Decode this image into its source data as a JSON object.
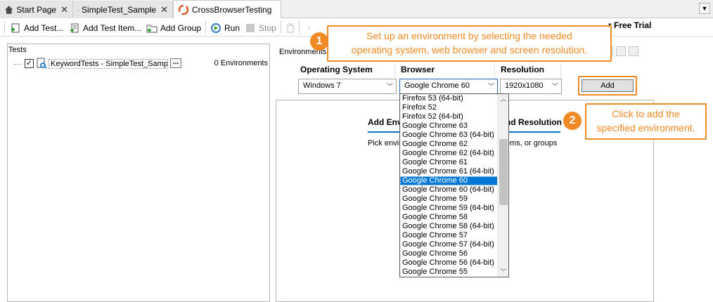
{
  "tabs": [
    {
      "label": "Start Page",
      "icon": "home-icon"
    },
    {
      "label": "SimpleTest_Sample",
      "icon": "project-icon"
    },
    {
      "label": "CrossBrowserTesting",
      "icon": "crossbrowser-icon",
      "active": true
    }
  ],
  "toolbar": {
    "add_test": "Add Test...",
    "add_test_item": "Add Test Item...",
    "add_group": "Add Group",
    "run": "Run",
    "stop": "Stop",
    "free_trial": "r Free Trial"
  },
  "left_pane": {
    "header": "Tests",
    "row": {
      "checked": true,
      "label": "KeywordTests - SimpleTest_Sample",
      "ellipsis": "...",
      "env_count": "0 Environments"
    }
  },
  "right_pane": {
    "environments_label": "Environments",
    "headers": {
      "os": "Operating System",
      "browser": "Browser",
      "resolution": "Resolution"
    },
    "os_value": "Windows 7",
    "browser_value": "Google Chrome 60",
    "resolution_value": "1920x1080",
    "add_button": "Add",
    "add_env_title_a": "Add Env",
    "add_env_title_b": "nd Resolution",
    "pick_hint_a": "Pick envir",
    "pick_hint_b": "ems, or groups"
  },
  "browser_options": [
    "Firefox 53 (64-bit)",
    "Firefox 52",
    "Firefox 52 (64-bit)",
    "Google Chrome 63",
    "Google Chrome 63 (64-bit)",
    "Google Chrome 62",
    "Google Chrome 62 (64-bit)",
    "Google Chrome 61",
    "Google Chrome 61 (64-bit)",
    "Google Chrome 60",
    "Google Chrome 60 (64-bit)",
    "Google Chrome 59",
    "Google Chrome 59 (64-bit)",
    "Google Chrome 58",
    "Google Chrome 58 (64-bit)",
    "Google Chrome 57",
    "Google Chrome 57 (64-bit)",
    "Google Chrome 56",
    "Google Chrome 56 (64-bit)",
    "Google Chrome 55"
  ],
  "selected_browser_index": 9,
  "callouts": {
    "one": {
      "badge": "1",
      "text_line1": "Set up an environment by selecting the needed",
      "text_line2": "operating system, web browser and screen resolution."
    },
    "two": {
      "badge": "2",
      "text_line1": "Click to add the",
      "text_line2": "specified environment."
    }
  },
  "colors": {
    "accent": "#f08a24",
    "selection": "#0078d7",
    "tab_underline": "#0a74c8"
  }
}
